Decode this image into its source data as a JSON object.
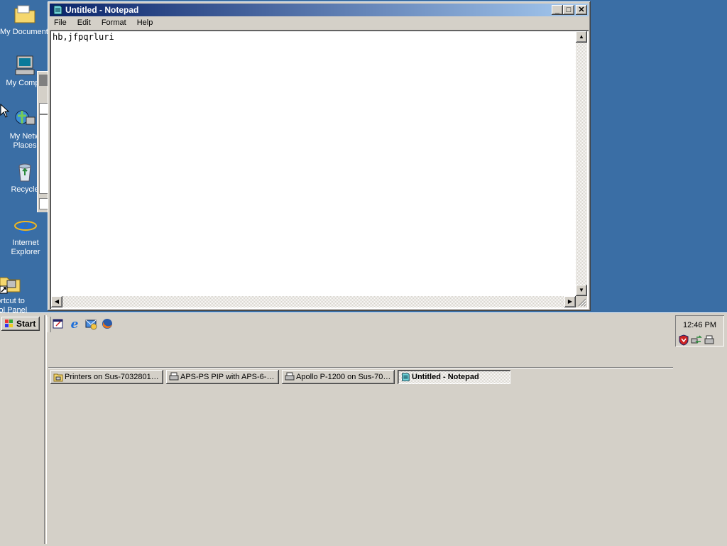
{
  "desktop": {
    "icons": [
      {
        "label": "My Documents",
        "icon": "folder-documents-icon"
      },
      {
        "label": "My Compu",
        "icon": "computer-icon"
      },
      {
        "label": "My Netw",
        "label2": "Places",
        "icon": "network-places-icon"
      },
      {
        "label": "Recycle",
        "icon": "recycle-bin-icon"
      },
      {
        "label": "Internet",
        "label2": "Explorer",
        "icon": "internet-explorer-icon"
      },
      {
        "label": "ortcut to",
        "label2": "trol Panel",
        "icon": "control-panel-shortcut-icon"
      }
    ]
  },
  "window": {
    "title": "Untitled - Notepad",
    "menu": [
      "File",
      "Edit",
      "Format",
      "Help"
    ],
    "content": "hb,jfpqrluri",
    "buttons": {
      "minimize": "_",
      "maximize": "□",
      "close": "✕"
    }
  },
  "taskbar": {
    "start_label": "Start",
    "quick_launch": [
      "show-desktop-icon",
      "internet-explorer-icon",
      "outlook-express-icon",
      "firefox-icon"
    ],
    "tasks": [
      {
        "label": "Printers on Sus-7032801e...",
        "icon": "printers-folder-icon",
        "active": false
      },
      {
        "label": "APS-PS PIP with APS-6-1...",
        "icon": "printer-icon",
        "active": false
      },
      {
        "label": "Apollo P-1200 on Sus-703...",
        "icon": "printer-icon",
        "active": false
      },
      {
        "label": "Untitled - Notepad",
        "icon": "notepad-icon",
        "active": true
      }
    ],
    "clock": "12:46 PM",
    "tray_icons": [
      "security-shield-icon",
      "network-icon",
      "printer-icon"
    ]
  },
  "colors": {
    "desktop": "#3a6ea5",
    "titlebar_start": "#0a246a",
    "titlebar_end": "#a6caf0",
    "face": "#d4d0c8"
  }
}
